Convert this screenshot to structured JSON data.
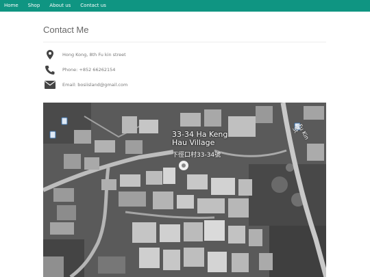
{
  "nav": {
    "items": [
      {
        "label": "Home"
      },
      {
        "label": "Shop"
      },
      {
        "label": "About us"
      },
      {
        "label": "Contact us"
      }
    ]
  },
  "page": {
    "title": "Contact Me"
  },
  "contact": {
    "address": "Hong Kong, 8th Fu kin street",
    "phone": "Phone: +852 66262154",
    "email": "Email: bosiisland@gmail.com"
  },
  "map": {
    "place_label_line1": "33-34 Ha Keng",
    "place_label_line2": "Hau Village",
    "place_label_cn": "下徑口村33-34號",
    "road_label": "Fu Kin St"
  },
  "colors": {
    "navbar": "#0f9582",
    "icon": "#444444"
  }
}
